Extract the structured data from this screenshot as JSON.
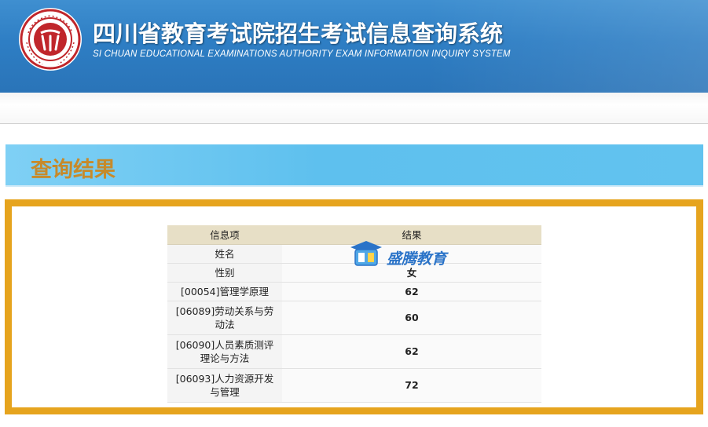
{
  "header": {
    "title_cn": "四川省教育考试院招生考试信息查询系统",
    "title_en": "SI CHUAN EDUCATIONAL EXAMINATIONS AUTHORITY EXAM INFORMATION INQUIRY SYSTEM",
    "logo_icon": "sceea-seal-icon"
  },
  "result": {
    "title": "查询结果"
  },
  "table": {
    "headers": [
      "信息项",
      "结果"
    ],
    "rows": [
      {
        "item": "姓名",
        "value": ""
      },
      {
        "item": "性别",
        "value": "女"
      },
      {
        "item": "[00054]管理学原理",
        "value": "62"
      },
      {
        "item": "[06089]劳动关系与劳动法",
        "value": "60"
      },
      {
        "item": "[06090]人员素质测评理论与方法",
        "value": "62"
      },
      {
        "item": "[06093]人力资源开发与管理",
        "value": "72"
      }
    ]
  },
  "watermark": {
    "text": "盛腾教育"
  },
  "colors": {
    "header_blue": "#2e7ec4",
    "banner_blue": "#5ec0ee",
    "title_gold": "#c78a2a",
    "frame_orange": "#e6a41e",
    "table_header": "#e7dfc6",
    "logo_red": "#c0262b"
  }
}
